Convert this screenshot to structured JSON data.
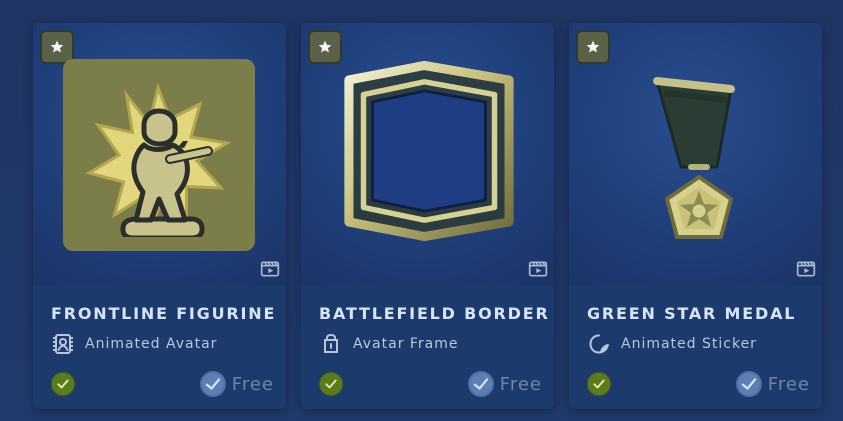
{
  "cards": [
    {
      "title": "FRONTLINE FIGURINE",
      "type_label": "Animated Avatar",
      "price_label": "Free",
      "badge_icon": "star-icon",
      "media_icon": "video-icon",
      "type_icon": "animated-avatar-icon",
      "owned_icon": "check-icon",
      "price_icon": "steam-points-icon"
    },
    {
      "title": "BATTLEFIELD BORDER",
      "type_label": "Avatar Frame",
      "price_label": "Free",
      "badge_icon": "star-icon",
      "media_icon": "video-icon",
      "type_icon": "avatar-frame-icon",
      "owned_icon": "check-icon",
      "price_icon": "steam-points-icon"
    },
    {
      "title": "GREEN STAR MEDAL",
      "type_label": "Animated Sticker",
      "price_label": "Free",
      "badge_icon": "star-icon",
      "media_icon": "video-icon",
      "type_icon": "animated-sticker-icon",
      "owned_icon": "check-icon",
      "price_icon": "steam-points-icon"
    }
  ],
  "colors": {
    "page_background": "#213a6c",
    "card_background": "#1d3a6c",
    "title_text": "#d7e5f8",
    "type_text": "#b7c7dd",
    "price_text": "#6d86aa",
    "owned_green": "#5b7b1d",
    "badge_olive": "#5b6146",
    "item_olive": "#7c7e49"
  }
}
